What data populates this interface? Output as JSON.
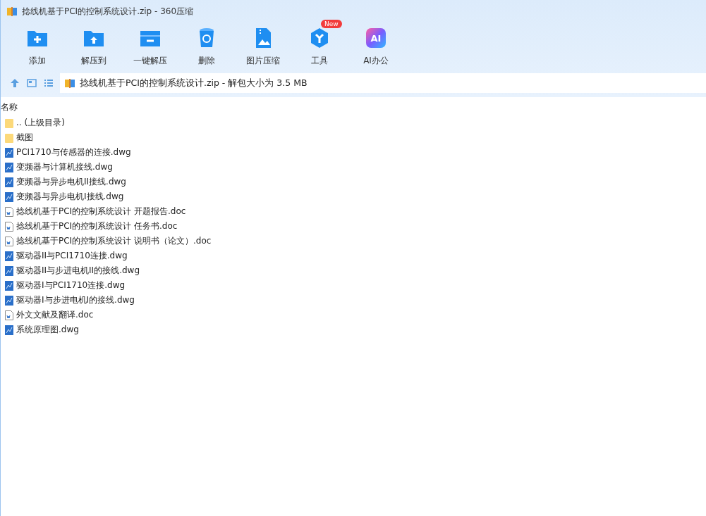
{
  "window": {
    "title": "捻线机基于PCI的控制系统设计.zip - 360压缩"
  },
  "toolbar": [
    {
      "kind": "add",
      "label": "添加"
    },
    {
      "kind": "extract",
      "label": "解压到"
    },
    {
      "kind": "oneclick",
      "label": "一键解压"
    },
    {
      "kind": "delete",
      "label": "删除"
    },
    {
      "kind": "image",
      "label": "图片压缩"
    },
    {
      "kind": "tools",
      "label": "工具",
      "badge": "New"
    },
    {
      "kind": "ai",
      "label": "AI办公",
      "icon_text": "AI"
    }
  ],
  "address": {
    "text": "捻线机基于PCI的控制系统设计.zip - 解包大小为 3.5 MB"
  },
  "table": {
    "columns": [
      "名称"
    ],
    "rows": [
      {
        "kind": "folder",
        "name": ".. (上级目录)"
      },
      {
        "kind": "folder",
        "name": "截图"
      },
      {
        "kind": "dwg",
        "name": "PCI1710与传感器的连接.dwg"
      },
      {
        "kind": "dwg",
        "name": "变频器与计算机接线.dwg"
      },
      {
        "kind": "dwg",
        "name": "变频器与异步电机II接线.dwg"
      },
      {
        "kind": "dwg",
        "name": "变频器与异步电机I接线.dwg"
      },
      {
        "kind": "doc",
        "name": "捻线机基于PCI的控制系统设计 开题报告.doc"
      },
      {
        "kind": "doc",
        "name": "捻线机基于PCI的控制系统设计 任务书.doc"
      },
      {
        "kind": "doc",
        "name": "捻线机基于PCI的控制系统设计 说明书（论文）.doc"
      },
      {
        "kind": "dwg",
        "name": "驱动器II与PCI1710连接.dwg"
      },
      {
        "kind": "dwg",
        "name": "驱动器II与步进电机II的接线.dwg"
      },
      {
        "kind": "dwg",
        "name": "驱动器I与PCI1710连接.dwg"
      },
      {
        "kind": "dwg",
        "name": "驱动器I与步进电机I的接线.dwg"
      },
      {
        "kind": "doc",
        "name": "外文文献及翻译.doc"
      },
      {
        "kind": "dwg",
        "name": "系统原理图.dwg"
      }
    ]
  }
}
